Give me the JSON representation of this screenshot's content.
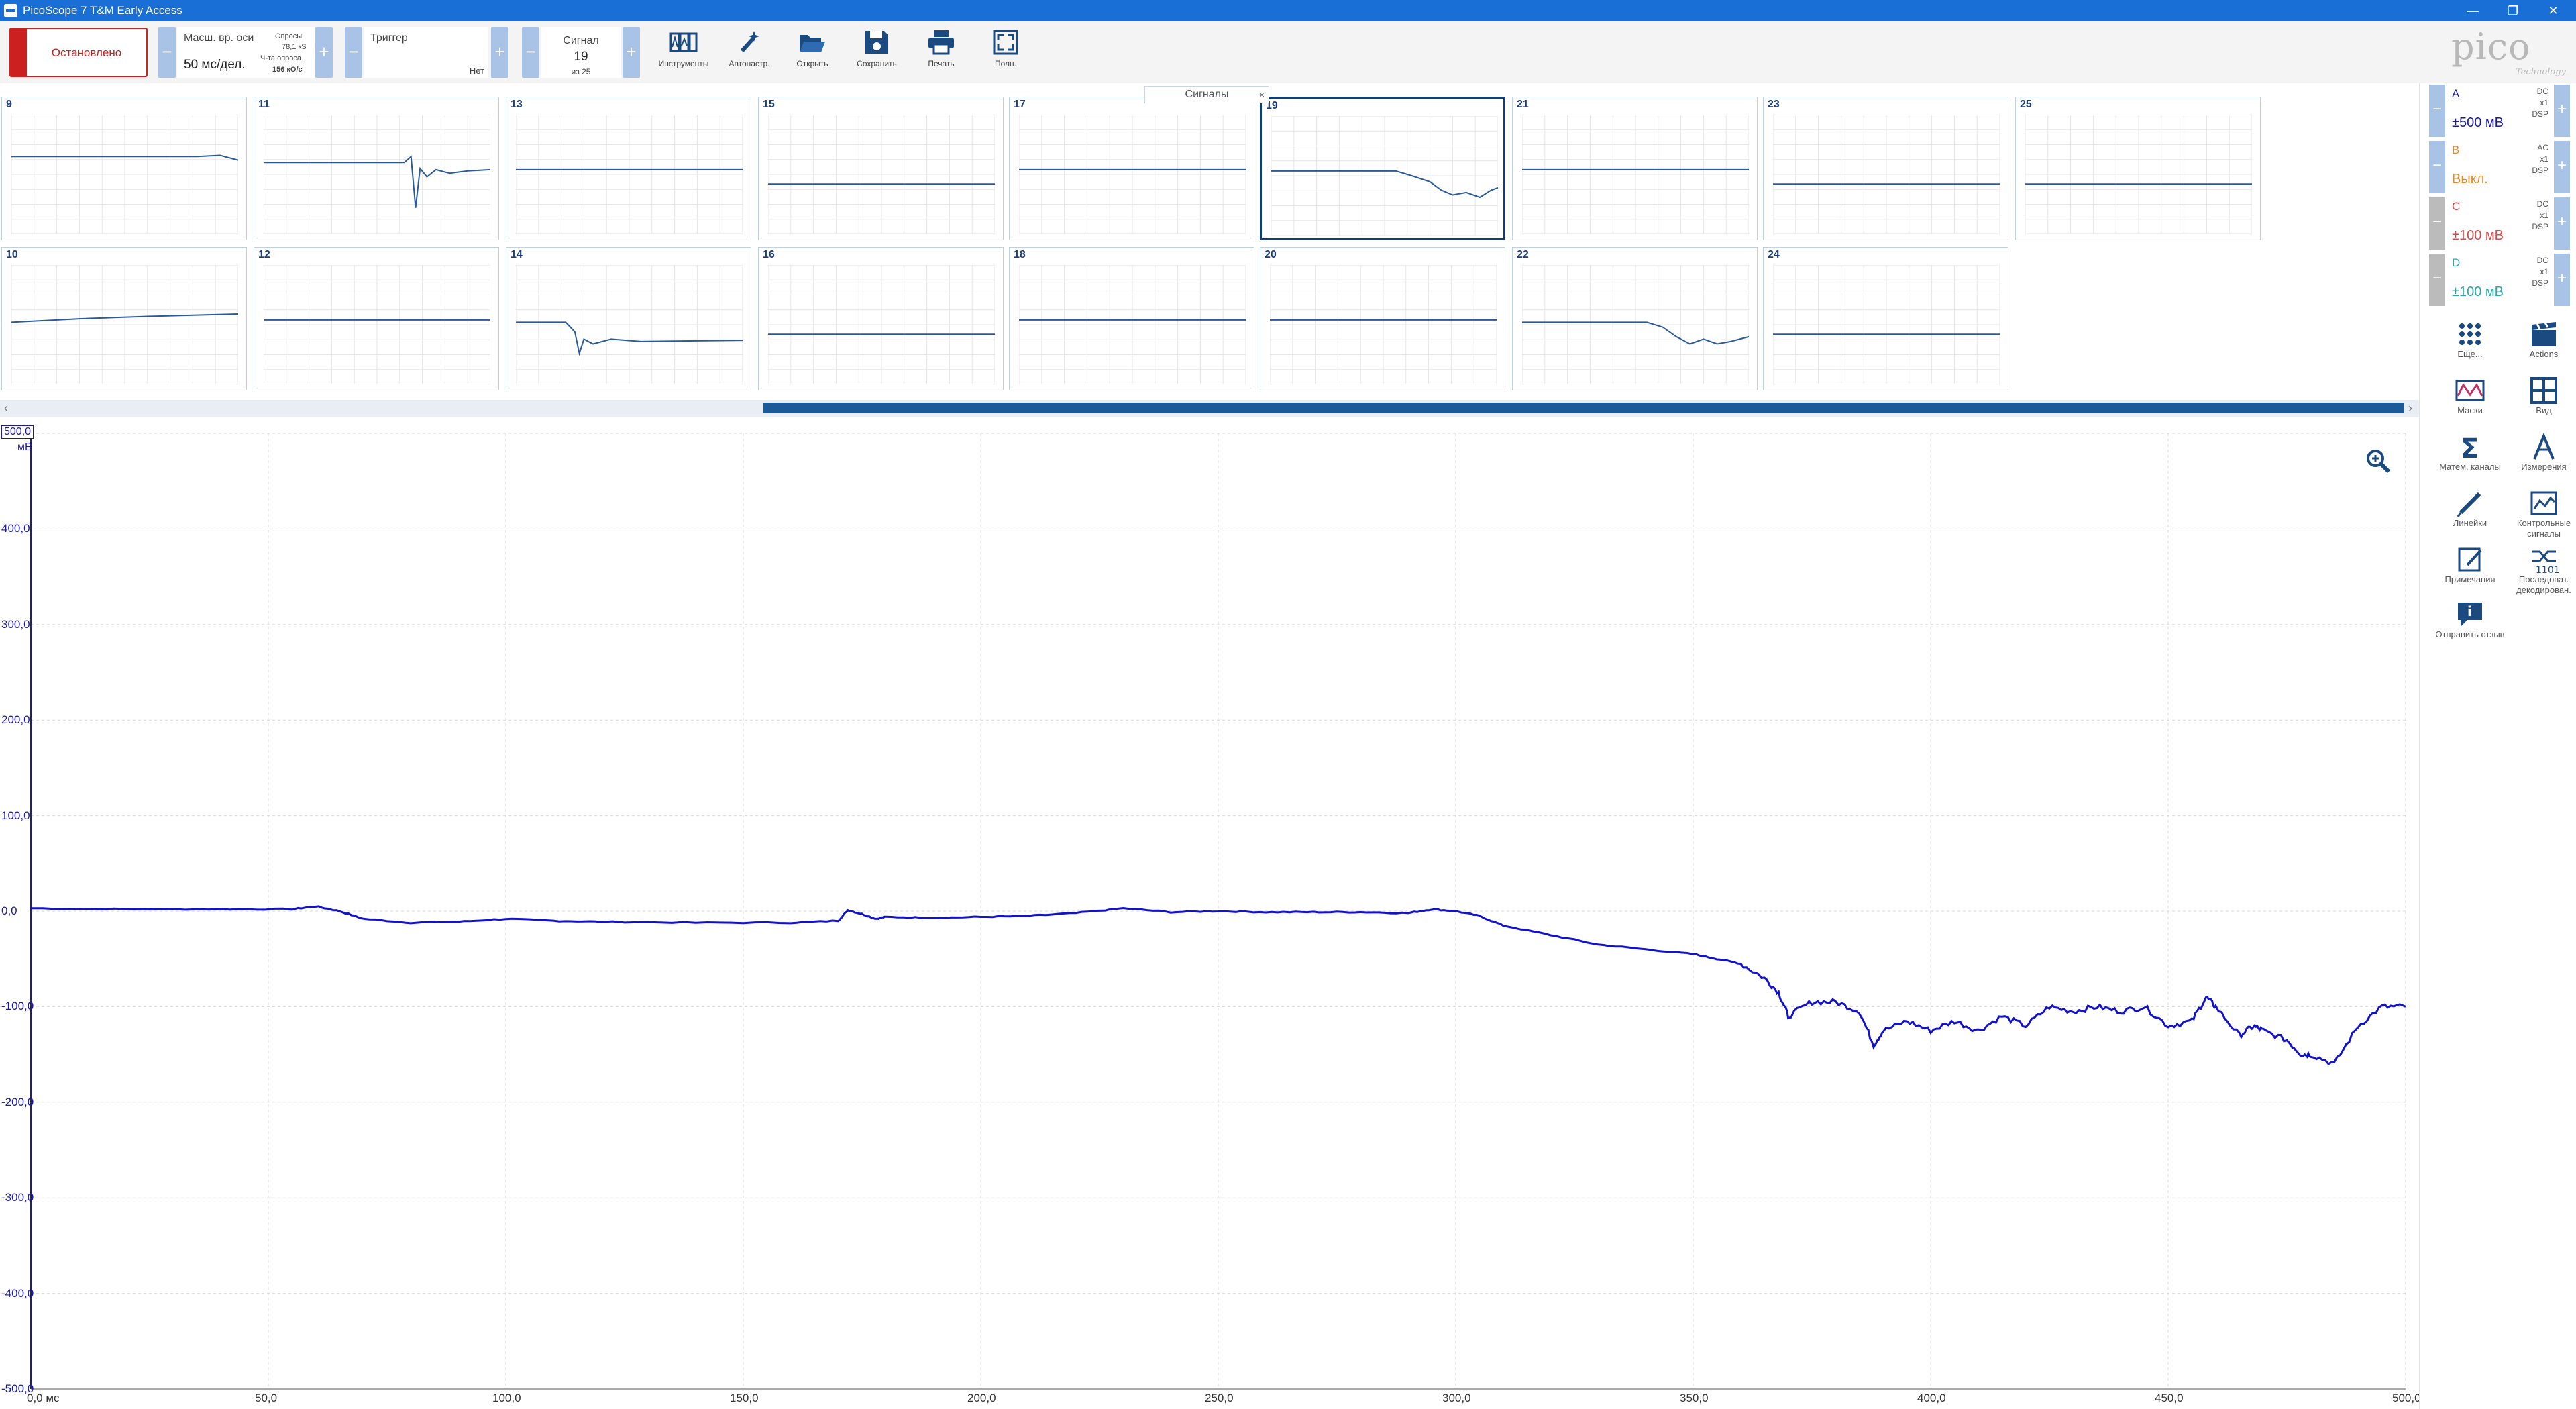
{
  "window": {
    "title": "PicoScope 7 T&M Early Access",
    "minimize": "—",
    "restore": "❐",
    "close": "✕"
  },
  "toolbar": {
    "run_status": "Остановлено",
    "timebase": {
      "label": "Масш. вр. оси",
      "value": "50 мс/дел.",
      "samples_label": "Опросы",
      "samples_value": "78,1 кS",
      "rate_label": "Ч-та опроса",
      "rate_value": "156 кО/с",
      "minus": "−",
      "plus": "+"
    },
    "trigger": {
      "label": "Триггер",
      "value": "Нет",
      "minus": "−",
      "plus": "+"
    },
    "signal": {
      "label": "Сигнал",
      "value": "19",
      "of": "из 25",
      "minus": "−",
      "plus": "+"
    },
    "tools": [
      {
        "id": "instruments",
        "label": "Инструменты"
      },
      {
        "id": "autosetup",
        "label": "Автонастр."
      },
      {
        "id": "open",
        "label": "Открыть"
      },
      {
        "id": "save",
        "label": "Сохранить"
      },
      {
        "id": "print",
        "label": "Печать"
      },
      {
        "id": "fullscreen",
        "label": "Полн."
      }
    ]
  },
  "logo": {
    "word": "pico",
    "sub": "Technology"
  },
  "signals_tab": {
    "label": "Сигналы",
    "close": "×"
  },
  "thumbnails": [
    {
      "n": "9",
      "shape": "flat_drop"
    },
    {
      "n": "11",
      "shape": "spike"
    },
    {
      "n": "13",
      "shape": "flat"
    },
    {
      "n": "15",
      "shape": "flat_low"
    },
    {
      "n": "17",
      "shape": "flat"
    },
    {
      "n": "19",
      "shape": "decline",
      "selected": true
    },
    {
      "n": "21",
      "shape": "flat"
    },
    {
      "n": "23",
      "shape": "flat_low"
    },
    {
      "n": "25",
      "shape": "flat_low"
    },
    {
      "n": "10",
      "shape": "rise"
    },
    {
      "n": "12",
      "shape": "flat"
    },
    {
      "n": "14",
      "shape": "spike_down"
    },
    {
      "n": "16",
      "shape": "flat_low"
    },
    {
      "n": "18",
      "shape": "flat"
    },
    {
      "n": "20",
      "shape": "flat"
    },
    {
      "n": "22",
      "shape": "dip"
    },
    {
      "n": "24",
      "shape": "flat_low"
    }
  ],
  "channels": [
    {
      "letter": "A",
      "coupling": [
        "DC",
        "x1",
        "DSP"
      ],
      "range": "±500 мВ",
      "color": "#1a1aa0",
      "off": false
    },
    {
      "letter": "B",
      "coupling": [
        "AC",
        "x1",
        "DSP"
      ],
      "range": "Выкл.",
      "color": "#e08a2a",
      "off": false
    },
    {
      "letter": "C",
      "coupling": [
        "DC",
        "x1",
        "DSP"
      ],
      "range": "±100 мВ",
      "color": "#d64a4a",
      "off": true
    },
    {
      "letter": "D",
      "coupling": [
        "DC",
        "x1",
        "DSP"
      ],
      "range": "±100 мВ",
      "color": "#2aa8a8",
      "off": true
    }
  ],
  "side_tools": [
    {
      "id": "more",
      "label": "Еще..."
    },
    {
      "id": "actions",
      "label": "Actions"
    },
    {
      "id": "masks",
      "label": "Маски"
    },
    {
      "id": "view",
      "label": "Вид"
    },
    {
      "id": "math",
      "label": "Матем. каналы"
    },
    {
      "id": "measurements",
      "label": "Измерения"
    },
    {
      "id": "rulers",
      "label": "Линейки"
    },
    {
      "id": "reference",
      "label": "Контрольные сигналы"
    },
    {
      "id": "serial",
      "label": "Последоват. декодирован."
    },
    {
      "id": "notes",
      "label": "Примечания"
    },
    {
      "id": "feedback",
      "label": "Отправить отзыв"
    }
  ],
  "scope": {
    "y_top_label": "500,0",
    "y_unit": "мВ",
    "y_ticks": [
      "400,0",
      "300,0",
      "200,0",
      "100,0",
      "0,0",
      "-100,0",
      "-200,0",
      "-300,0",
      "-400,0",
      "-500,0"
    ],
    "x_ticks": [
      "0,0 мс",
      "50,0",
      "100,0",
      "150,0",
      "200,0",
      "250,0",
      "300,0",
      "350,0",
      "400,0",
      "450,0",
      "500,0"
    ]
  },
  "chart_data": {
    "type": "line",
    "x_unit": "мс",
    "y_unit": "мВ",
    "xlim": [
      0,
      500
    ],
    "ylim": [
      -500,
      500
    ],
    "grid": true,
    "series": [
      {
        "color": "#1212cc",
        "x": [
          0,
          20,
          40,
          55,
          60,
          65,
          70,
          80,
          90,
          100,
          110,
          120,
          140,
          160,
          170,
          172,
          175,
          178,
          180,
          190,
          200,
          210,
          220,
          230,
          240,
          250,
          260,
          270,
          280,
          290,
          295,
          300,
          305,
          310,
          320,
          330,
          340,
          350,
          355,
          360,
          365,
          368,
          370,
          375,
          380,
          385,
          388,
          390,
          395,
          400,
          405,
          410,
          415,
          420,
          425,
          430,
          435,
          440,
          445,
          450,
          455,
          458,
          460,
          465,
          468,
          470,
          475,
          478,
          480,
          485,
          490,
          495,
          500
        ],
        "y": [
          3,
          2,
          2,
          2,
          5,
          0,
          -8,
          -12,
          -11,
          -8,
          -10,
          -11,
          -12,
          -12,
          -10,
          1,
          -3,
          -8,
          -6,
          -7,
          -6,
          -5,
          -2,
          3,
          -1,
          0,
          -1,
          -1,
          -1,
          -2,
          2,
          0,
          -5,
          -15,
          -25,
          -35,
          -40,
          -45,
          -50,
          -55,
          -70,
          -85,
          -110,
          -95,
          -95,
          -105,
          -140,
          -125,
          -115,
          -125,
          -115,
          -125,
          -110,
          -120,
          -100,
          -105,
          -100,
          -105,
          -100,
          -120,
          -115,
          -90,
          -100,
          -130,
          -120,
          -125,
          -135,
          -150,
          -150,
          -160,
          -120,
          -100,
          -100
        ]
      }
    ]
  }
}
